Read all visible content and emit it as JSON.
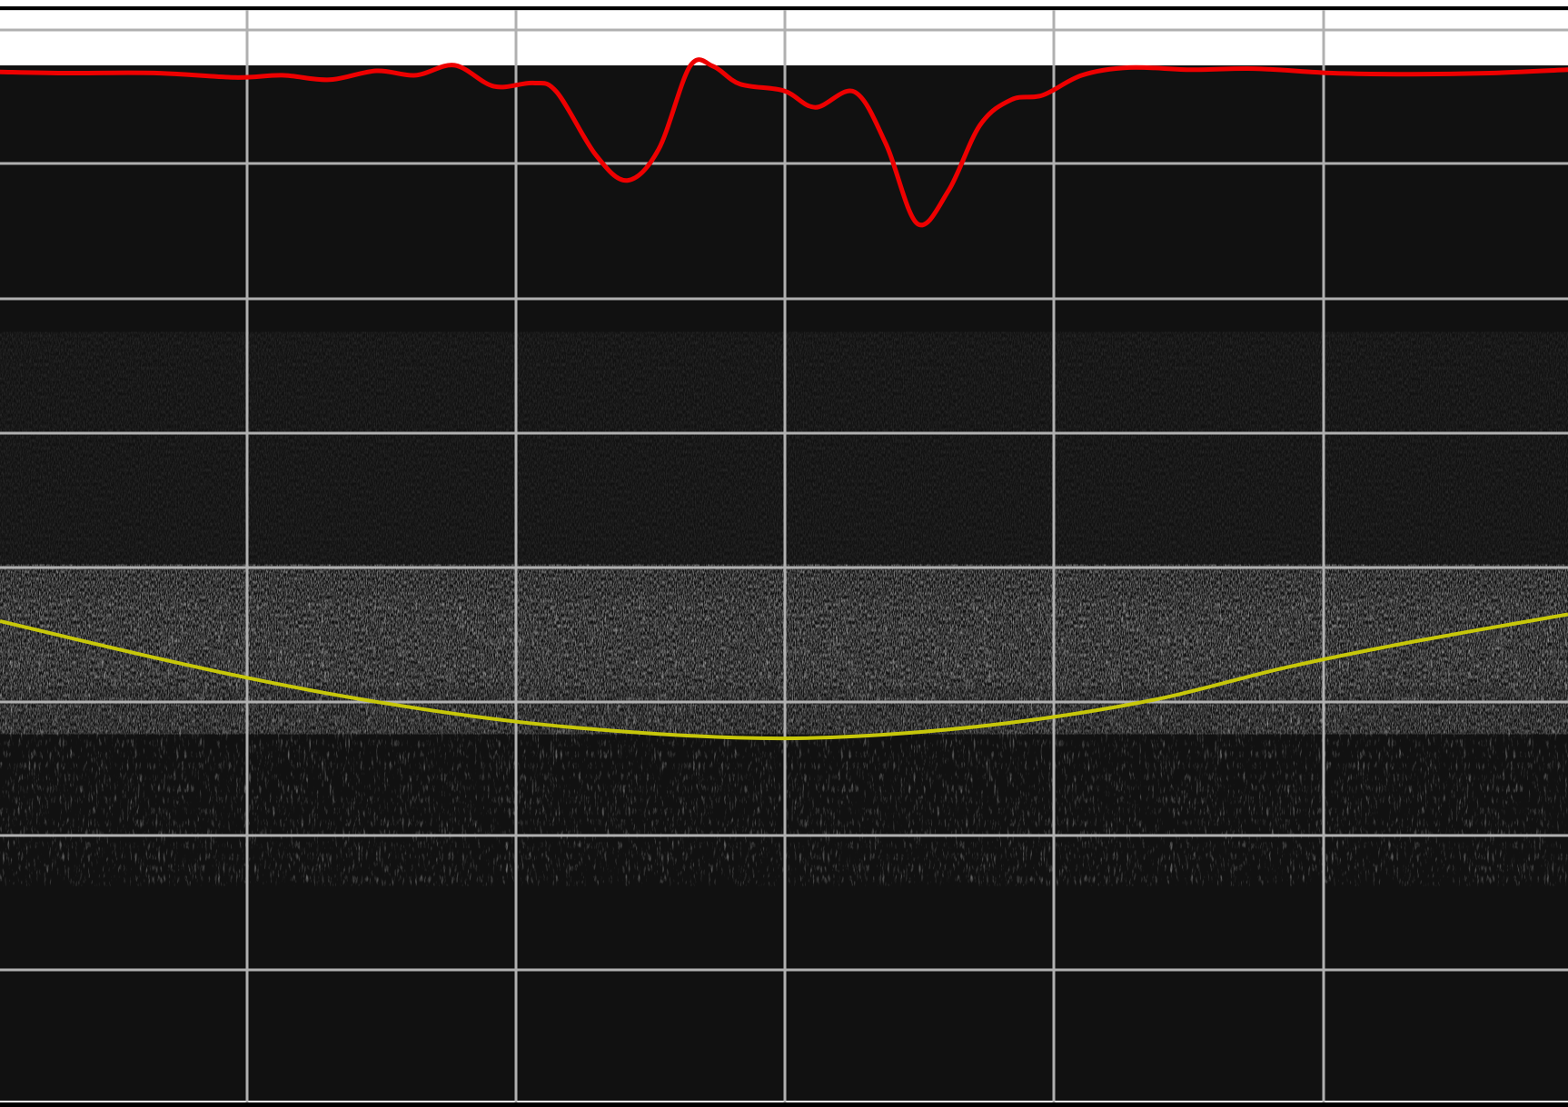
{
  "image": {
    "description_type": "oct-bscan-with-grid-and-traces",
    "colors": {
      "page_background": "#ffffff",
      "frame_border": "#000000",
      "scan_background": "#111111",
      "grid_line": "#b0b0b0",
      "retina_tissue": "#d8d8d8",
      "rpe_band": "#ffffff",
      "choroid_texture": "#6a6a6a",
      "red_trace": "#ee0000",
      "yellow_trace": "#c7c70a"
    },
    "traces": {
      "red": {
        "name": "red-trace",
        "samples": [
          [
            0.0,
            0.065
          ],
          [
            0.04,
            0.066
          ],
          [
            0.1,
            0.066
          ],
          [
            0.15,
            0.07
          ],
          [
            0.18,
            0.068
          ],
          [
            0.21,
            0.072
          ],
          [
            0.24,
            0.064
          ],
          [
            0.265,
            0.068
          ],
          [
            0.29,
            0.059
          ],
          [
            0.315,
            0.078
          ],
          [
            0.34,
            0.075
          ],
          [
            0.355,
            0.083
          ],
          [
            0.38,
            0.14
          ],
          [
            0.4,
            0.163
          ],
          [
            0.42,
            0.135
          ],
          [
            0.44,
            0.06
          ],
          [
            0.455,
            0.06
          ],
          [
            0.472,
            0.076
          ],
          [
            0.5,
            0.082
          ],
          [
            0.52,
            0.097
          ],
          [
            0.545,
            0.083
          ],
          [
            0.565,
            0.13
          ],
          [
            0.585,
            0.202
          ],
          [
            0.605,
            0.172
          ],
          [
            0.625,
            0.113
          ],
          [
            0.645,
            0.09
          ],
          [
            0.665,
            0.086
          ],
          [
            0.69,
            0.068
          ],
          [
            0.72,
            0.061
          ],
          [
            0.76,
            0.063
          ],
          [
            0.8,
            0.062
          ],
          [
            0.85,
            0.066
          ],
          [
            0.9,
            0.067
          ],
          [
            0.95,
            0.066
          ],
          [
            1.0,
            0.063
          ]
        ]
      },
      "yellow": {
        "name": "yellow-trace",
        "samples": [
          [
            0.0,
            0.561
          ],
          [
            0.08,
            0.588
          ],
          [
            0.16,
            0.613
          ],
          [
            0.24,
            0.634
          ],
          [
            0.33,
            0.652
          ],
          [
            0.42,
            0.663
          ],
          [
            0.5,
            0.667
          ],
          [
            0.58,
            0.662
          ],
          [
            0.66,
            0.65
          ],
          [
            0.74,
            0.631
          ],
          [
            0.82,
            0.603
          ],
          [
            0.9,
            0.58
          ],
          [
            1.0,
            0.555
          ]
        ]
      }
    },
    "grid": {
      "name": "measurement-grid",
      "columns": 6,
      "rows": 8
    }
  }
}
